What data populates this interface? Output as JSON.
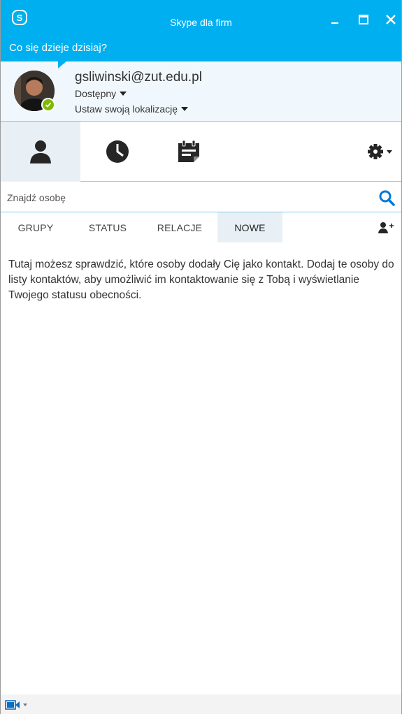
{
  "window": {
    "title": "Skype dla firm",
    "accent_color": "#00aff0"
  },
  "whats_up": "Co się dzieje dzisiaj?",
  "profile": {
    "email": "gsliwinski@zut.edu.pl",
    "status": "Dostępny",
    "location": "Ustaw swoją lokalizację",
    "presence_color": "#7fba00"
  },
  "icon_tabs": [
    "contacts-icon",
    "history-clock-icon",
    "meetings-icon",
    "gear-icon"
  ],
  "search": {
    "placeholder": "Znajdź osobę"
  },
  "tabs": {
    "groups": "GRUPY",
    "status": "STATUS",
    "relations": "RELACJE",
    "new": "NOWE",
    "active": "NOWE"
  },
  "info": "Tutaj możesz sprawdzić, które osoby dodały Cię jako kontakt. Dodaj te osoby do listy kontaktów, aby umożliwić im kontaktowanie się z Tobą i wyświetlanie Twojego statusu obecności."
}
